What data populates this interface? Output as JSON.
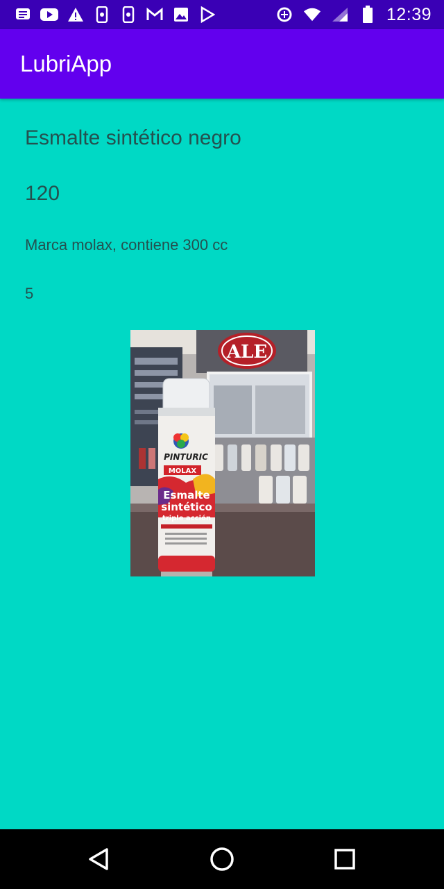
{
  "status_bar": {
    "time": "12:39",
    "left_icons": [
      "message-icon",
      "youtube-icon",
      "warning-icon",
      "phone-notification-icon",
      "phone-notification-icon",
      "gmail-icon",
      "image-icon",
      "play-store-icon"
    ],
    "right_icons": [
      "data-saver-icon",
      "wifi-icon",
      "signal-icon",
      "battery-icon"
    ]
  },
  "app_bar": {
    "title": "LubriApp"
  },
  "product": {
    "name": "Esmalte sintético negro",
    "price": "120",
    "description": "Marca molax, contiene 300 cc",
    "stock": "5",
    "image_label": "Spray can photo",
    "image_text": {
      "brand": "PINTURIC",
      "sub": "MOLAX",
      "line1": "Esmalte",
      "line2": "sintético",
      "line3": "triple acción",
      "store_sign": "ALE"
    }
  },
  "nav_bar": {
    "buttons": [
      "back-icon",
      "home-icon",
      "recents-icon"
    ]
  },
  "colors": {
    "status": "#3a00b5",
    "appbar": "#6200ee",
    "background": "#00d9c5",
    "text": "#24514f"
  }
}
